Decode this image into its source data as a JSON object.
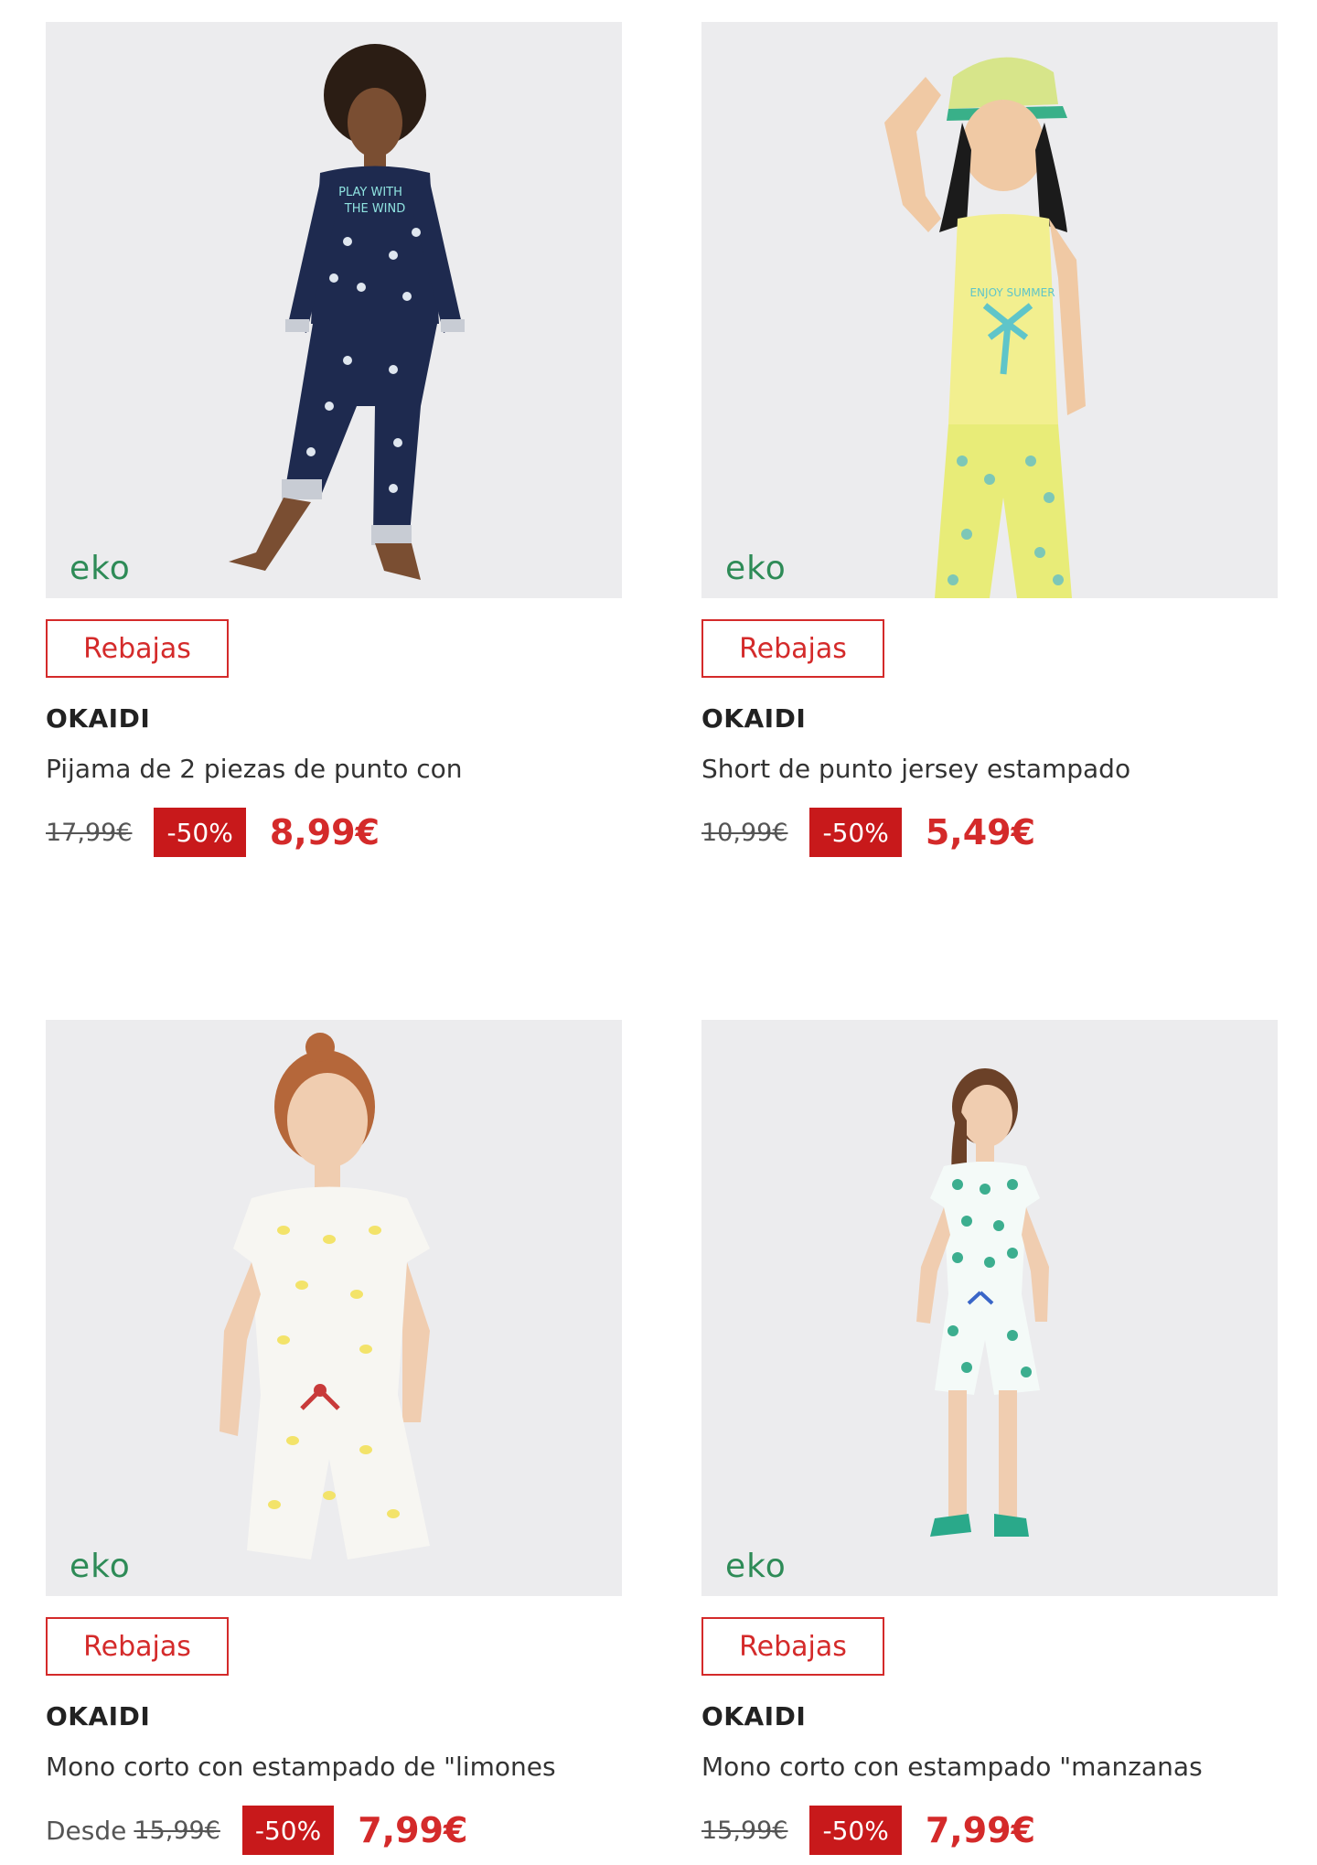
{
  "colors": {
    "sale_red": "#d42a2a",
    "discount_bg": "#c8191b",
    "eko_green": "#2e8b57",
    "photo_bg": "#ececee"
  },
  "products": [
    {
      "image_alt": "Niño con pijama azul marino estampado",
      "logo": "eko",
      "badge": "Rebajas",
      "brand": "OKAIDI",
      "title": "Pijama de 2 piezas de punto con",
      "price_prefix": "",
      "old_price": "17,99€",
      "discount": "-50%",
      "new_price": "8,99€"
    },
    {
      "image_alt": "Niña con camiseta amarilla y short estampado",
      "logo": "eko",
      "badge": "Rebajas",
      "brand": "OKAIDI",
      "title": "Short de punto jersey estampado",
      "price_prefix": "",
      "old_price": "10,99€",
      "discount": "-50%",
      "new_price": "5,49€"
    },
    {
      "image_alt": "Niña con mono corto estampado de limones",
      "logo": "eko",
      "badge": "Rebajas",
      "brand": "OKAIDI",
      "title": "Mono corto con estampado de \"limones",
      "price_prefix": "Desde",
      "old_price": "15,99€",
      "discount": "-50%",
      "new_price": "7,99€"
    },
    {
      "image_alt": "Niña con mono corto estampado de manzanas",
      "logo": "eko",
      "badge": "Rebajas",
      "brand": "OKAIDI",
      "title": "Mono corto con estampado \"manzanas",
      "price_prefix": "",
      "old_price": "15,99€",
      "discount": "-50%",
      "new_price": "7,99€"
    }
  ]
}
